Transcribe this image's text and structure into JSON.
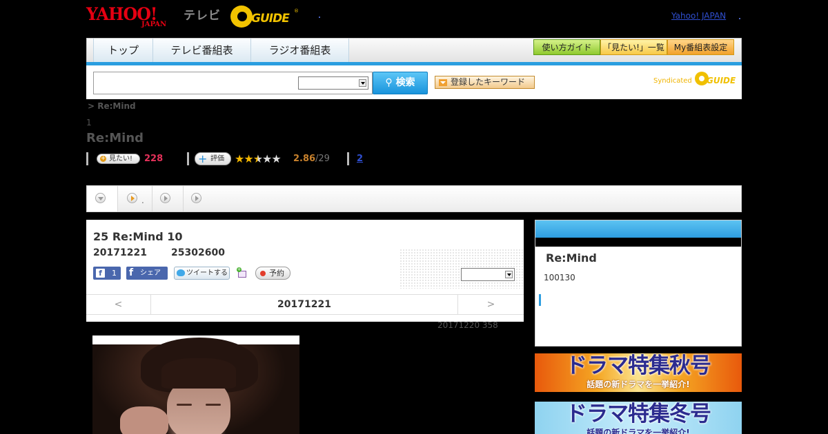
{
  "header": {
    "yahoo_logo": "YAHOO!",
    "yahoo_logo_sub": "JAPAN",
    "tv_label": "テレビ",
    "gguide_logo": "GUIDE",
    "yahoo_link": "Yahoo! JAPAN"
  },
  "nav": {
    "tabs": [
      "トップ",
      "テレビ番組表",
      "ラジオ番組表"
    ],
    "buttons": [
      "使い方ガイド",
      "「見たい!」一覧",
      "My番組表設定"
    ]
  },
  "search": {
    "placeholder": "",
    "select_value": "",
    "button_label": "検索",
    "keyword_button": "登録したキーワード",
    "syndicated_label": "Syndicated",
    "syndicated_logo": "GUIDE"
  },
  "breadcrumb": "> Re:Mind",
  "count_label": "1",
  "page_title": "Re:Mind",
  "meta": {
    "mitai_label": "見たい!",
    "mitai_count": "228",
    "hyoka_label": "評価",
    "stars_filled": 2.5,
    "stars_total": 5,
    "rating": "2.86",
    "rating_count": "/29",
    "review_count": "2"
  },
  "tabstrip": {
    "tab2_text": "."
  },
  "program": {
    "title": "25 Re:Mind 10",
    "date": "20171221",
    "time": "25302600",
    "fb_like_count": "1",
    "fb_share_label": "シェア",
    "tweet_label": "ツイートする",
    "reserve_label": "予約",
    "select_value": "",
    "prev_label": "<",
    "current_date": "20171221",
    "next_label": ">",
    "update_info": "20171220  358"
  },
  "sidebar": {
    "title": "Re:Mind",
    "count": "100130"
  },
  "banners": {
    "autumn": {
      "title": "ドラマ特集秋号",
      "subtitle": "話題の新ドラマを一挙紹介!"
    },
    "winter": {
      "title": "ドラマ特集冬号",
      "subtitle": "話題の新ドラマを一挙紹介!"
    }
  },
  "colors": {
    "accent_blue": "#2a9ee0",
    "mitai_pink": "#e4315a",
    "rating_orange": "#c9822d",
    "star_gold": "#f2b600"
  }
}
